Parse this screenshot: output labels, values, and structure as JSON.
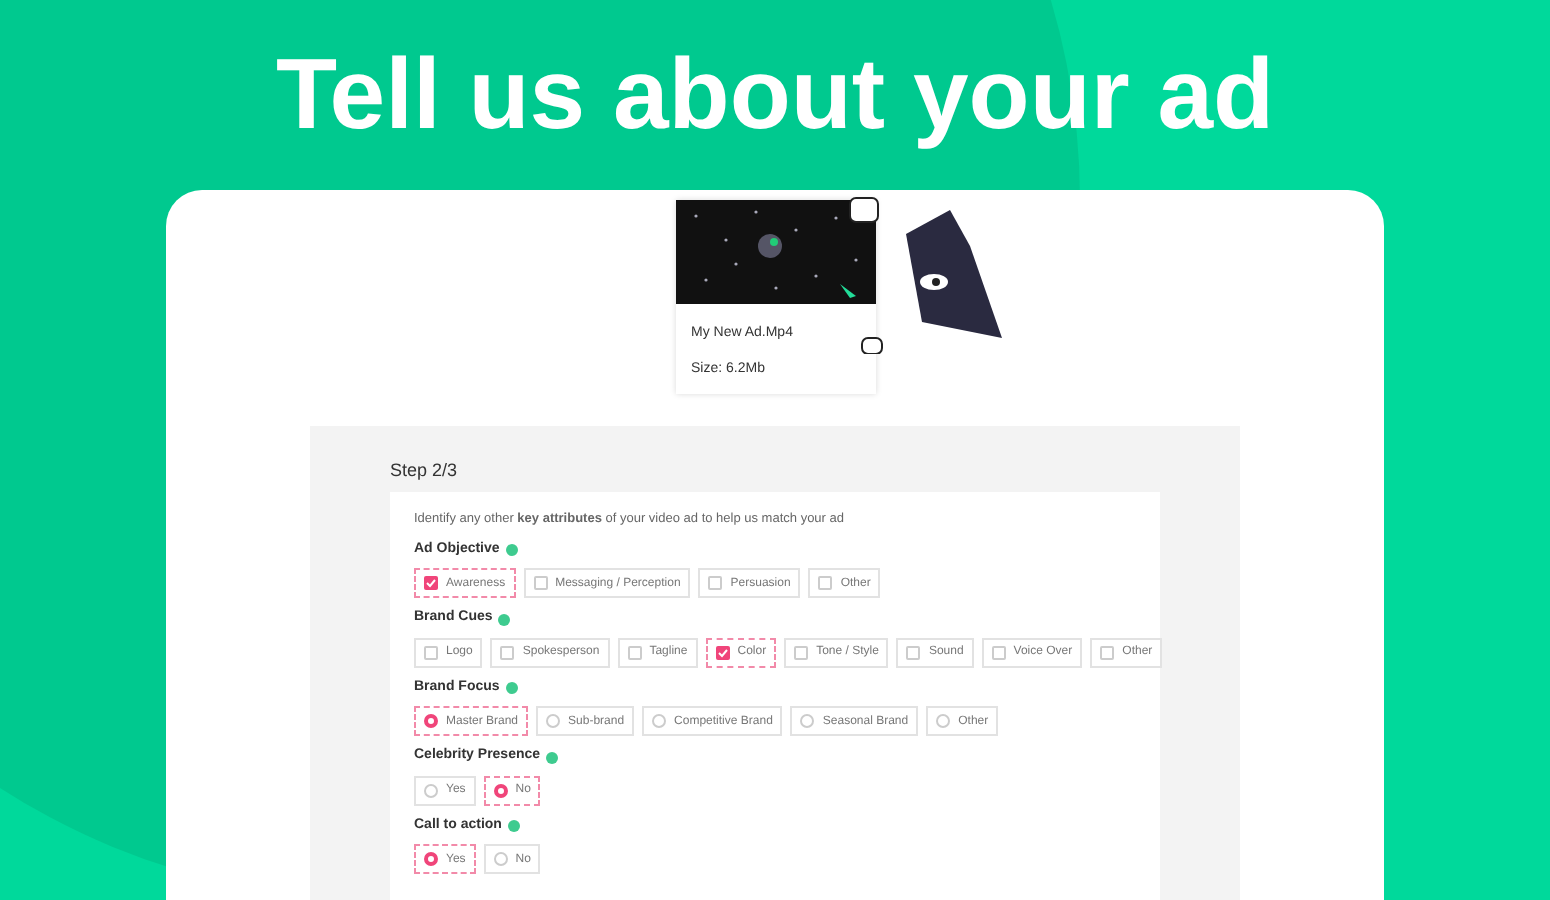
{
  "headline": "Tell us about your ad",
  "file": {
    "name": "My New Ad.Mp4",
    "size": "Size: 6.2Mb"
  },
  "step": "Step 2/3",
  "intro": "Identify any other **key attributes** of your video ad to help us match your ad",
  "groups": [
    {
      "label": "Ad Objective",
      "kind": "checkbox",
      "options": [
        {
          "label": "Awareness",
          "selected": true
        },
        {
          "label": "Messaging / Perception",
          "selected": false
        },
        {
          "label": "Persuasion",
          "selected": false
        },
        {
          "label": "Other",
          "selected": false
        }
      ]
    },
    {
      "label": "Brand Cues",
      "kind": "checkbox",
      "options": [
        {
          "label": "Logo",
          "selected": false
        },
        {
          "label": "Spokesperson",
          "selected": false
        },
        {
          "label": "Tagline",
          "selected": false
        },
        {
          "label": "Color",
          "selected": true
        },
        {
          "label": "Tone / Style",
          "selected": false
        },
        {
          "label": "Sound",
          "selected": false
        },
        {
          "label": "Voice Over",
          "selected": false
        },
        {
          "label": "Other",
          "selected": false
        }
      ]
    },
    {
      "label": "Brand Focus",
      "kind": "radio",
      "options": [
        {
          "label": "Master Brand",
          "selected": true
        },
        {
          "label": "Sub-brand",
          "selected": false
        },
        {
          "label": "Competitive Brand",
          "selected": false
        },
        {
          "label": "Seasonal Brand",
          "selected": false
        },
        {
          "label": "Other",
          "selected": false
        }
      ]
    },
    {
      "label": "Celebrity Presence",
      "kind": "radio",
      "options": [
        {
          "label": "Yes",
          "selected": false
        },
        {
          "label": "No",
          "selected": true
        }
      ]
    },
    {
      "label": "Call to action",
      "kind": "radio",
      "options": [
        {
          "label": "Yes",
          "selected": true
        },
        {
          "label": "No",
          "selected": false
        }
      ]
    }
  ]
}
